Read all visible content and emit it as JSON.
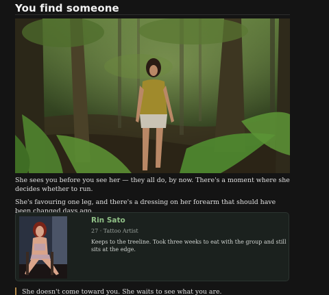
{
  "scene": {
    "title": "You find someone",
    "paragraphs": [
      "She sees you before you see her — they all do, by now. There's a moment where she decides whether to run.",
      "She's favouring one leg, and there's a dressing on her forearm that should have been changed days ago."
    ],
    "quote": "She doesn't come toward you. She waits to see what you are."
  },
  "character": {
    "name": "Rin Sato",
    "meta": "27 · Tattoo Artist",
    "description": "Keeps to the treeline. Took three weeks to eat with the group and still sits at the edge."
  },
  "colors": {
    "background": "#141414",
    "card_background": "#1b211e",
    "name_accent": "#8fbf86",
    "quote_bar": "#b58a4a"
  }
}
